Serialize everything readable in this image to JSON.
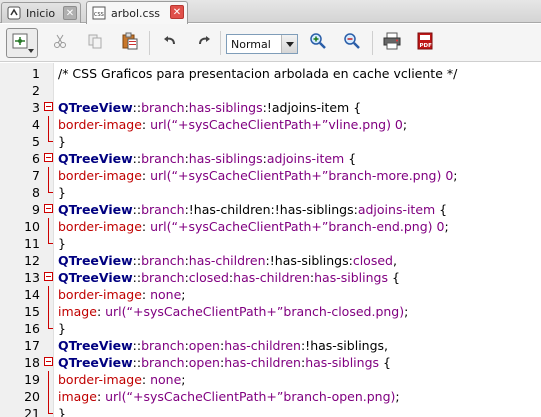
{
  "tabs": [
    {
      "label": "Inicio",
      "icon": "home-page-icon",
      "active": false
    },
    {
      "label": "arbol.css",
      "icon": "css-file-icon",
      "active": true
    }
  ],
  "toolbar": {
    "zoom_value": "Normal",
    "buttons": [
      "document-menu-icon",
      "cut-icon",
      "copy-icon",
      "paste-icon",
      "undo-icon",
      "redo-icon",
      "zoom-in-icon",
      "zoom-out-icon",
      "print-icon",
      "pdf-export-icon"
    ]
  },
  "editor": {
    "lines": [
      {
        "n": "1",
        "fold": "",
        "parts": [
          [
            "c-comment",
            "/* CSS Graficos para presentacion arbolada en cache vcliente */"
          ]
        ]
      },
      {
        "n": "2",
        "fold": "",
        "parts": []
      },
      {
        "n": "3",
        "fold": "open",
        "parts": [
          [
            "c-sel",
            "QTreeView"
          ],
          [
            "c-punct",
            "::"
          ],
          [
            "c-pseudo",
            "branch"
          ],
          [
            "c-punct",
            ":"
          ],
          [
            "c-pseudo",
            "has-siblings"
          ],
          [
            "c-punct",
            ":!adjoins-item {"
          ]
        ]
      },
      {
        "n": "4",
        "fold": "mid",
        "parts": [
          [
            "c-prop",
            "border-image"
          ],
          [
            "c-punct",
            ": "
          ],
          [
            "c-val",
            "url(“+sysCacheClientPath+”vline.png) 0"
          ],
          [
            "c-punct",
            ";"
          ]
        ]
      },
      {
        "n": "5",
        "fold": "end",
        "parts": [
          [
            "c-punct",
            "}"
          ]
        ]
      },
      {
        "n": "6",
        "fold": "open",
        "parts": [
          [
            "c-sel",
            "QTreeView"
          ],
          [
            "c-punct",
            "::"
          ],
          [
            "c-pseudo",
            "branch"
          ],
          [
            "c-punct",
            ":"
          ],
          [
            "c-pseudo",
            "has-siblings"
          ],
          [
            "c-punct",
            ":"
          ],
          [
            "c-pseudo",
            "adjoins-item"
          ],
          [
            "c-punct",
            " {"
          ]
        ]
      },
      {
        "n": "7",
        "fold": "mid",
        "parts": [
          [
            "c-prop",
            "border-image"
          ],
          [
            "c-punct",
            ": "
          ],
          [
            "c-val",
            "url(“+sysCacheClientPath+”branch-more.png) 0"
          ],
          [
            "c-punct",
            ";"
          ]
        ]
      },
      {
        "n": "8",
        "fold": "end",
        "parts": [
          [
            "c-punct",
            "}"
          ]
        ]
      },
      {
        "n": "9",
        "fold": "open",
        "parts": [
          [
            "c-sel",
            "QTreeView"
          ],
          [
            "c-punct",
            "::"
          ],
          [
            "c-pseudo",
            "branch"
          ],
          [
            "c-punct",
            ":!has-children:!has-siblings:"
          ],
          [
            "c-pseudo",
            "adjoins-item"
          ],
          [
            "c-punct",
            " {"
          ]
        ]
      },
      {
        "n": "10",
        "fold": "mid",
        "parts": [
          [
            "c-prop",
            "border-image"
          ],
          [
            "c-punct",
            ": "
          ],
          [
            "c-val",
            "url(“+sysCacheClientPath+”branch-end.png) 0"
          ],
          [
            "c-punct",
            ";"
          ]
        ]
      },
      {
        "n": "11",
        "fold": "end",
        "parts": [
          [
            "c-punct",
            "}"
          ]
        ]
      },
      {
        "n": "12",
        "fold": "",
        "parts": [
          [
            "c-sel",
            "QTreeView"
          ],
          [
            "c-punct",
            "::"
          ],
          [
            "c-pseudo",
            "branch"
          ],
          [
            "c-punct",
            ":"
          ],
          [
            "c-pseudo",
            "has-children"
          ],
          [
            "c-punct",
            ":!has-siblings:"
          ],
          [
            "c-pseudo",
            "closed"
          ],
          [
            "c-punct",
            ","
          ]
        ]
      },
      {
        "n": "13",
        "fold": "open",
        "parts": [
          [
            "c-sel",
            "QTreeView"
          ],
          [
            "c-punct",
            "::"
          ],
          [
            "c-pseudo",
            "branch"
          ],
          [
            "c-punct",
            ":"
          ],
          [
            "c-pseudo",
            "closed"
          ],
          [
            "c-punct",
            ":"
          ],
          [
            "c-pseudo",
            "has-children"
          ],
          [
            "c-punct",
            ":"
          ],
          [
            "c-pseudo",
            "has-siblings"
          ],
          [
            "c-punct",
            " {"
          ]
        ]
      },
      {
        "n": "14",
        "fold": "mid",
        "parts": [
          [
            "c-prop",
            "border-image"
          ],
          [
            "c-punct",
            ": "
          ],
          [
            "c-val",
            "none"
          ],
          [
            "c-punct",
            ";"
          ]
        ]
      },
      {
        "n": "15",
        "fold": "mid",
        "parts": [
          [
            "c-prop",
            "image"
          ],
          [
            "c-punct",
            ": "
          ],
          [
            "c-val",
            "url(“+sysCacheClientPath+”branch-closed.png)"
          ],
          [
            "c-punct",
            ";"
          ]
        ]
      },
      {
        "n": "16",
        "fold": "end",
        "parts": [
          [
            "c-punct",
            "}"
          ]
        ]
      },
      {
        "n": "17",
        "fold": "",
        "parts": [
          [
            "c-sel",
            "QTreeView"
          ],
          [
            "c-punct",
            "::"
          ],
          [
            "c-pseudo",
            "branch"
          ],
          [
            "c-punct",
            ":"
          ],
          [
            "c-pseudo",
            "open"
          ],
          [
            "c-punct",
            ":"
          ],
          [
            "c-pseudo",
            "has-children"
          ],
          [
            "c-punct",
            ":!has-siblings,"
          ]
        ]
      },
      {
        "n": "18",
        "fold": "open",
        "parts": [
          [
            "c-sel",
            "QTreeView"
          ],
          [
            "c-punct",
            "::"
          ],
          [
            "c-pseudo",
            "branch"
          ],
          [
            "c-punct",
            ":"
          ],
          [
            "c-pseudo",
            "open"
          ],
          [
            "c-punct",
            ":"
          ],
          [
            "c-pseudo",
            "has-children"
          ],
          [
            "c-punct",
            ":"
          ],
          [
            "c-pseudo",
            "has-siblings"
          ],
          [
            "c-punct",
            " {"
          ]
        ]
      },
      {
        "n": "19",
        "fold": "mid",
        "parts": [
          [
            "c-prop",
            "border-image"
          ],
          [
            "c-punct",
            ": "
          ],
          [
            "c-val",
            "none"
          ],
          [
            "c-punct",
            ";"
          ]
        ]
      },
      {
        "n": "20",
        "fold": "mid",
        "parts": [
          [
            "c-prop",
            "image"
          ],
          [
            "c-punct",
            ": "
          ],
          [
            "c-val",
            "url(“+sysCacheClientPath+”branch-open.png)"
          ],
          [
            "c-punct",
            ";"
          ]
        ]
      },
      {
        "n": "21",
        "fold": "end",
        "parts": [
          [
            "c-punct",
            "}"
          ]
        ]
      }
    ]
  }
}
